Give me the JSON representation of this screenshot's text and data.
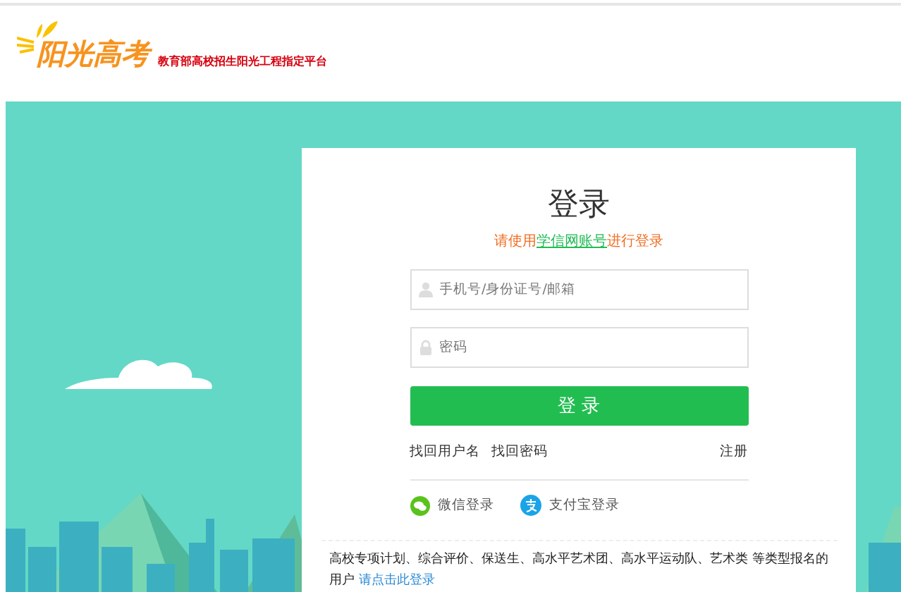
{
  "header": {
    "logo_text": "阳光高考",
    "tagline": "教育部高校招生阳光工程指定平台"
  },
  "login": {
    "title": "登录",
    "hint_prefix": "请使用",
    "hint_link": "学信网账号",
    "hint_suffix": "进行登录",
    "fields": [
      {
        "kind": "user",
        "placeholder": "手机号/身份证号/邮箱"
      },
      {
        "kind": "password",
        "placeholder": "密码"
      }
    ],
    "submit": "登 录",
    "links_left": [
      "找回用户名",
      "找回密码"
    ],
    "link_right": "注册",
    "social": [
      {
        "kind": "wechat",
        "label": "微信登录"
      },
      {
        "kind": "alipay",
        "label": "支付宝登录"
      }
    ],
    "notice": "高校专项计划、综合评价、保送生、高水平艺术团、高水平运动队、艺术类 等类型报名的用户",
    "notice_link": "请点击此登录"
  }
}
